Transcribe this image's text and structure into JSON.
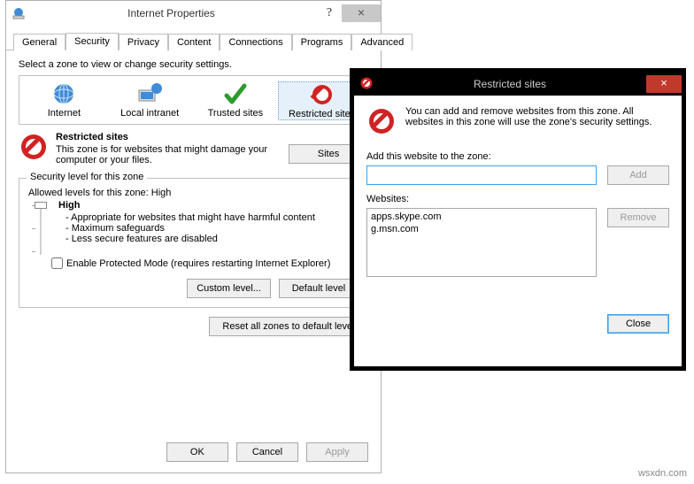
{
  "ip": {
    "title": "Internet Properties",
    "help_glyph": "?",
    "close_glyph": "×",
    "tabs": [
      "General",
      "Security",
      "Privacy",
      "Content",
      "Connections",
      "Programs",
      "Advanced"
    ],
    "active_tab": "Security",
    "zone_prompt": "Select a zone to view or change security settings.",
    "zones": [
      "Internet",
      "Local intranet",
      "Trusted sites",
      "Restricted sites"
    ],
    "selected_zone": "Restricted sites",
    "zone_heading": "Restricted sites",
    "zone_desc": "This zone is for websites that might damage your computer or your files.",
    "sites_btn": "Sites",
    "group_legend": "Security level for this zone",
    "allowed_levels": "Allowed levels for this zone: High",
    "level_name": "High",
    "level_bullets": [
      "Appropriate for websites that might have harmful content",
      "Maximum safeguards",
      "Less secure features are disabled"
    ],
    "protected_mode": "Enable Protected Mode (requires restarting Internet Explorer)",
    "custom_level_btn": "Custom level...",
    "default_level_btn": "Default level",
    "reset_all_btn": "Reset all zones to default level",
    "ok_btn": "OK",
    "cancel_btn": "Cancel",
    "apply_btn": "Apply"
  },
  "rs": {
    "title": "Restricted sites",
    "close_glyph": "×",
    "info_text": "You can add and remove websites from this zone. All websites in this zone will use the zone's security settings.",
    "add_label": "Add this website to the zone:",
    "add_input_value": "",
    "add_btn": "Add",
    "websites_label": "Websites:",
    "websites": [
      "apps.skype.com",
      "g.msn.com"
    ],
    "remove_btn": "Remove",
    "close_btn": "Close"
  },
  "watermark": "wsxdn.com"
}
